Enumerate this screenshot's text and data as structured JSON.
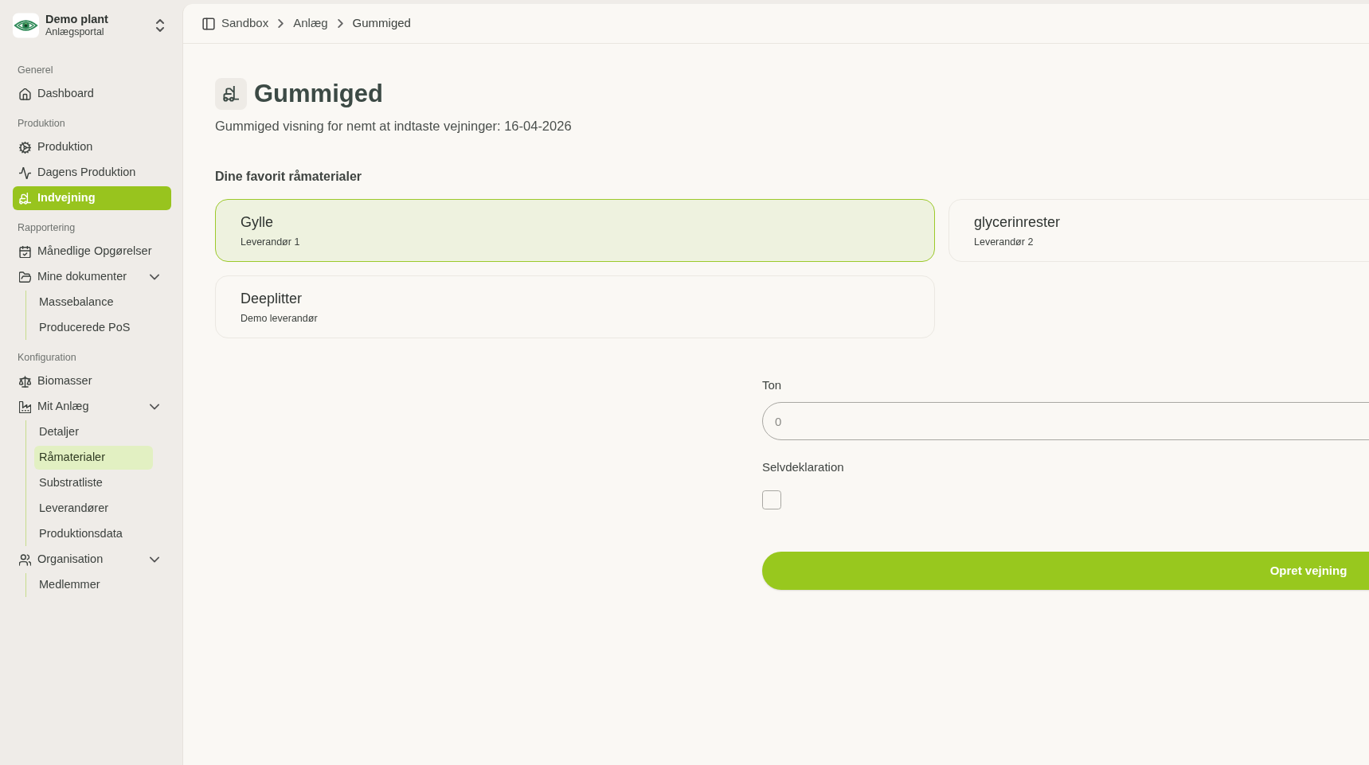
{
  "workspace": {
    "name": "Demo plant",
    "subtitle": "Anlægsportal"
  },
  "sidebar": {
    "sections": [
      {
        "title": "Generel",
        "items": [
          {
            "label": "Dashboard",
            "selected": false
          }
        ]
      },
      {
        "title": "Produktion",
        "items": [
          {
            "label": "Produktion",
            "selected": false
          },
          {
            "label": "Dagens Produktion",
            "selected": false
          },
          {
            "label": "Indvejning",
            "selected": true
          }
        ]
      },
      {
        "title": "Rapportering",
        "items": [
          {
            "label": "Månedlige Opgørelser",
            "selected": false
          },
          {
            "label": "Mine dokumenter",
            "selected": false,
            "expanded": true,
            "children": [
              {
                "label": "Massebalance",
                "selected": false
              },
              {
                "label": "Producerede PoS",
                "selected": false
              }
            ]
          }
        ]
      },
      {
        "title": "Konfiguration",
        "items": [
          {
            "label": "Biomasser",
            "selected": false
          },
          {
            "label": "Mit Anlæg",
            "selected": false,
            "expanded": true,
            "children": [
              {
                "label": "Detaljer",
                "selected": false
              },
              {
                "label": "Råmaterialer",
                "selected": true
              },
              {
                "label": "Substratliste",
                "selected": false
              },
              {
                "label": "Leverandører",
                "selected": false
              },
              {
                "label": "Produktionsdata",
                "selected": false
              }
            ]
          },
          {
            "label": "Organisation",
            "selected": false,
            "expanded": true,
            "children": [
              {
                "label": "Medlemmer",
                "selected": false
              }
            ]
          }
        ]
      }
    ]
  },
  "breadcrumb": [
    "Sandbox",
    "Anlæg",
    "Gummiged"
  ],
  "page": {
    "title": "Gummiged",
    "description": "Gummiged visning for nemt at indtaste vejninger: 16-04-2026"
  },
  "favorites": {
    "heading": "Dine favorit råmaterialer",
    "items": [
      {
        "name": "Gylle",
        "supplier": "Leverandør 1",
        "selected": true
      },
      {
        "name": "glycerinrester",
        "supplier": "Leverandør 2",
        "selected": false
      },
      {
        "name": "Deeplitter",
        "supplier": "Demo leverandør",
        "selected": false
      }
    ]
  },
  "form": {
    "fields": [
      {
        "kind": "number",
        "label": "Ton",
        "placeholder": "0"
      },
      {
        "kind": "checkbox",
        "label": "Selvdeklaration",
        "checked": false
      }
    ],
    "submit": "Opret vejning"
  }
}
